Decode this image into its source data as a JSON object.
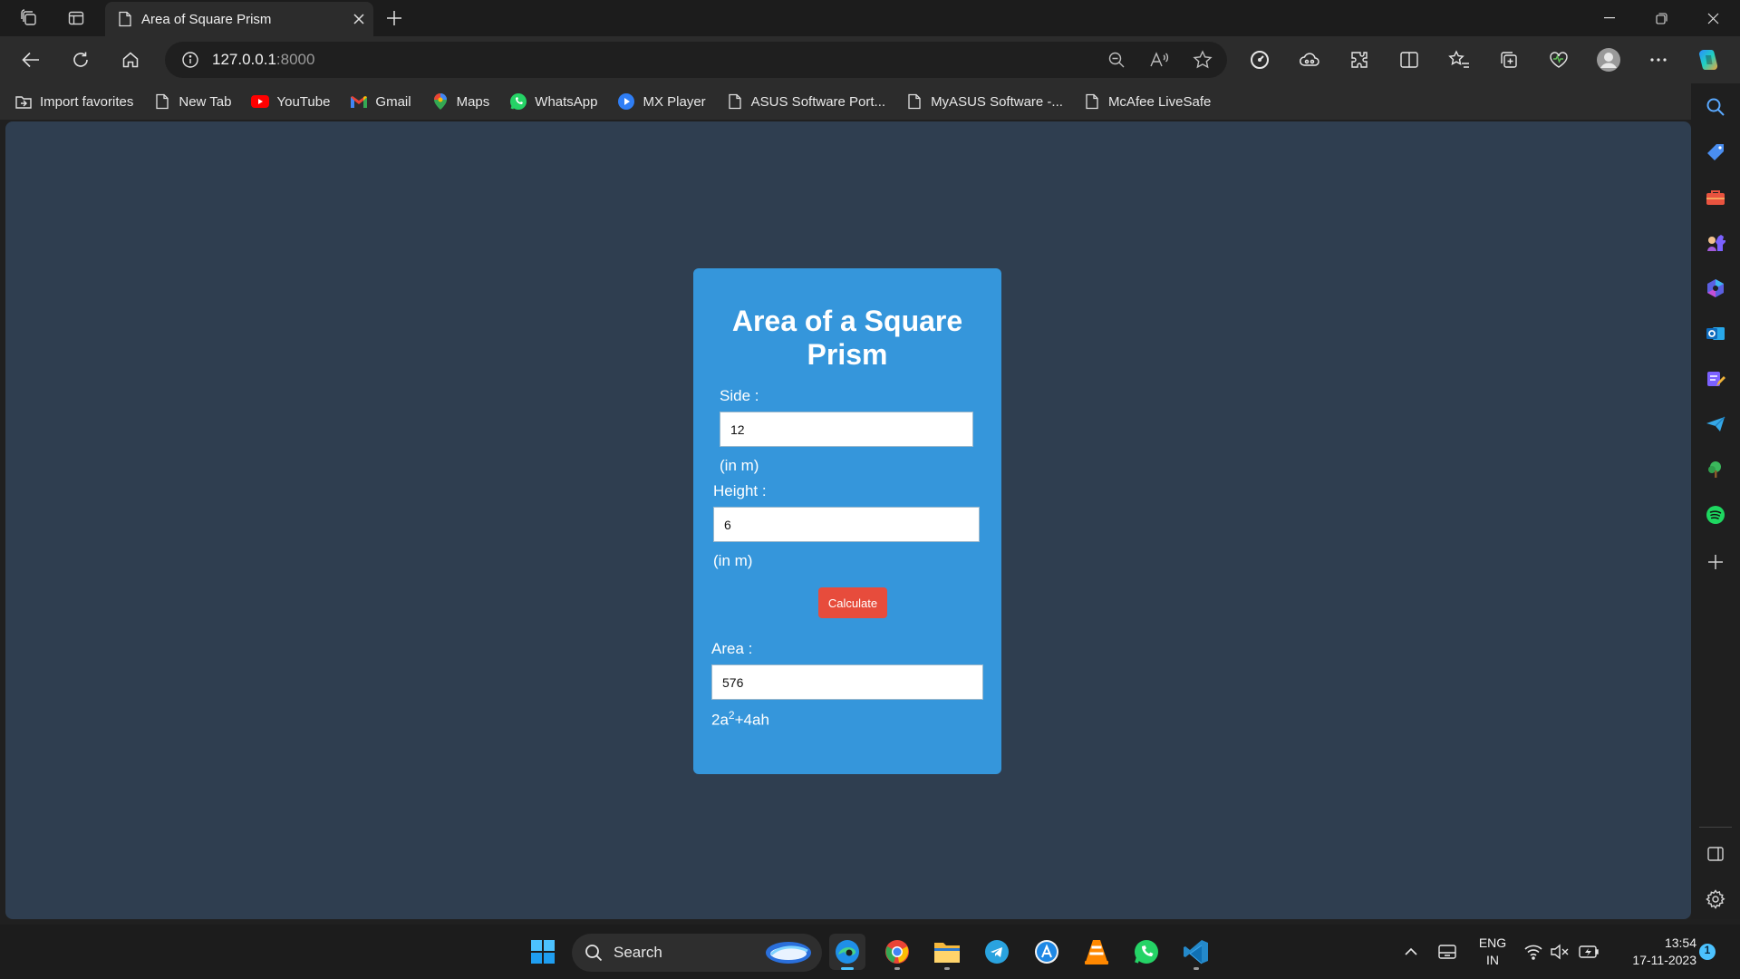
{
  "browser": {
    "tab_title": "Area of Square Prism",
    "url_host": "127.0.0.1",
    "url_port": ":8000"
  },
  "favorites": [
    {
      "label": "Import favorites",
      "icon": "import-icon"
    },
    {
      "label": "New Tab",
      "icon": "page-icon"
    },
    {
      "label": "YouTube",
      "icon": "youtube-icon"
    },
    {
      "label": "Gmail",
      "icon": "gmail-icon"
    },
    {
      "label": "Maps",
      "icon": "maps-icon"
    },
    {
      "label": "WhatsApp",
      "icon": "whatsapp-icon"
    },
    {
      "label": "MX Player",
      "icon": "mx-player-icon"
    },
    {
      "label": "ASUS Software Port...",
      "icon": "page-icon"
    },
    {
      "label": "MyASUS Software -...",
      "icon": "page-icon"
    },
    {
      "label": "McAfee LiveSafe",
      "icon": "page-icon"
    }
  ],
  "form": {
    "title": "Area of a Square Prism",
    "side_label": "Side :",
    "side_value": "12",
    "side_unit": "(in m)",
    "height_label": "Height :",
    "height_value": "6",
    "height_unit": "(in m)",
    "calculate_label": "Calculate",
    "area_label": "Area :",
    "area_value": "576",
    "formula_prefix": "2a",
    "formula_exponent": "2",
    "formula_suffix": "+4ah"
  },
  "taskbar": {
    "search_label": "Search",
    "lang_top": "ENG",
    "lang_bottom": "IN",
    "time": "13:54",
    "date": "17-11-2023",
    "notification_count": "1"
  },
  "colors": {
    "page_bg": "#2f3e50",
    "card_bg": "#3596db",
    "button_bg": "#e74c3c"
  }
}
